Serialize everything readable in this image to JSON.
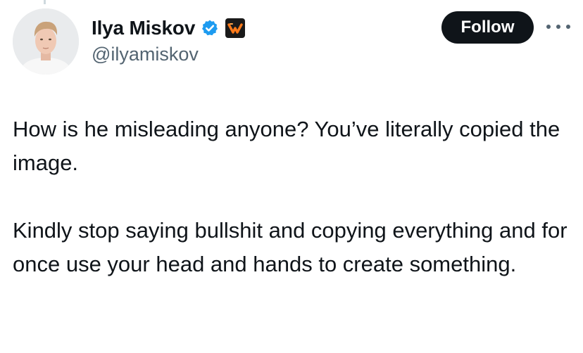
{
  "author": {
    "display_name": "Ilya Miskov",
    "handle": "@ilyamiskov",
    "verified_icon": "verified-badge-icon",
    "affiliate_icon": "affiliate-badge-icon",
    "accent_color": "#1d9bf0"
  },
  "actions": {
    "follow_label": "Follow",
    "more_icon": "more-options-icon"
  },
  "tweet": {
    "paragraphs": [
      "How is he misleading anyone? You’ve literally copied the image.",
      "Kindly stop saying bullshit and copying everything and for once use your head and hands to create something."
    ]
  }
}
